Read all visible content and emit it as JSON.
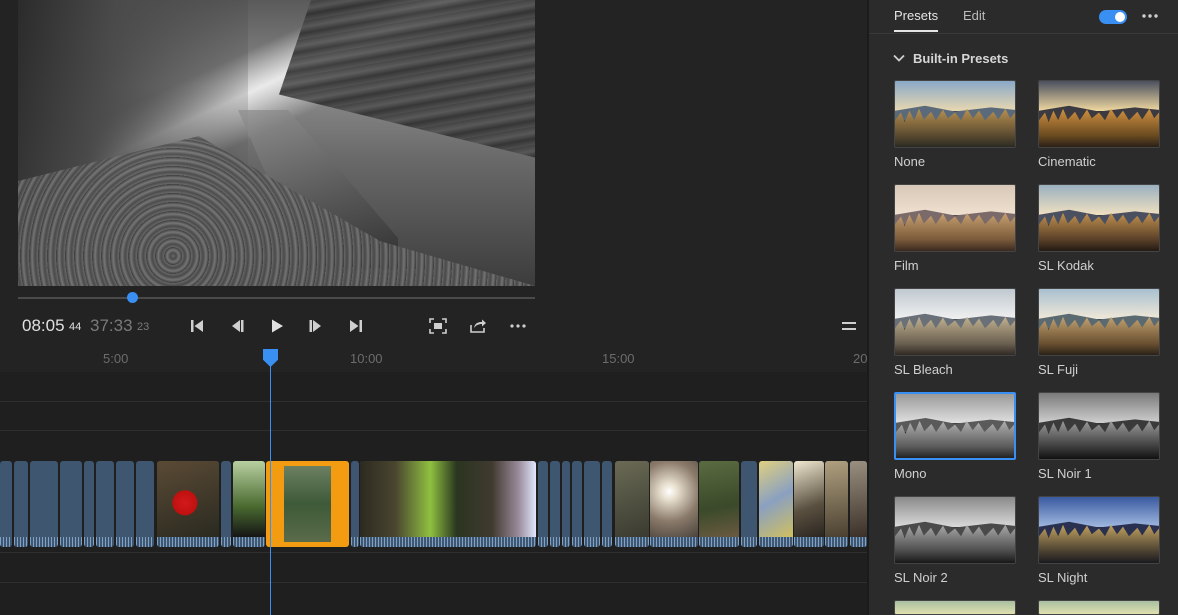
{
  "player": {
    "current_time": "08:05",
    "current_frames": "44",
    "total_time": "37:33",
    "total_frames": "23",
    "playhead_fraction": 0.22
  },
  "ruler": {
    "labels": [
      "5:00",
      "10:00",
      "15:00",
      "20"
    ]
  },
  "panel": {
    "tabs": [
      "Presets",
      "Edit"
    ],
    "active_tab": "Presets",
    "toggle_on": true,
    "section_title": "Built-in Presets",
    "presets": [
      {
        "label": "None",
        "style": "natural"
      },
      {
        "label": "Cinematic",
        "style": "warm"
      },
      {
        "label": "Film",
        "style": "film"
      },
      {
        "label": "SL Kodak",
        "style": "kodak"
      },
      {
        "label": "SL Bleach",
        "style": "bleach"
      },
      {
        "label": "SL Fuji",
        "style": "fuji"
      },
      {
        "label": "Mono",
        "style": "mono",
        "selected": true
      },
      {
        "label": "SL Noir 1",
        "style": "noir"
      },
      {
        "label": "SL Noir 2",
        "style": "noir2"
      },
      {
        "label": "SL Night",
        "style": "night"
      }
    ]
  },
  "colors": {
    "accent": "#3a8ff2",
    "selected_clip": "#f39c12",
    "clip_default": "#3e5670"
  },
  "icons": {
    "skip_start": "skip-start-icon",
    "step_back": "step-back-icon",
    "play": "play-icon",
    "step_forward": "step-forward-icon",
    "skip_end": "skip-end-icon",
    "fit": "fit-to-screen-icon",
    "share": "share-icon",
    "more": "more-icon",
    "menu": "hamburger-menu-icon",
    "chevron": "chevron-down-icon"
  }
}
